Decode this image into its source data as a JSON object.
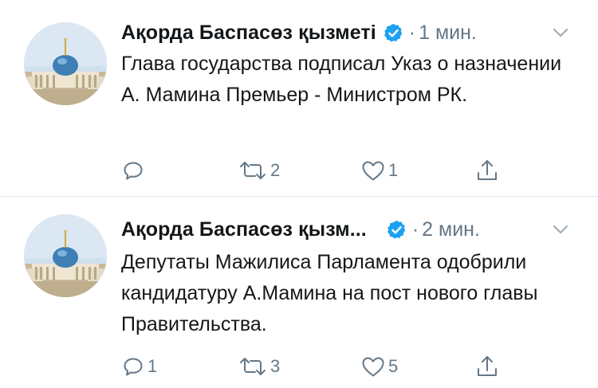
{
  "colors": {
    "text": "#14171a",
    "muted": "#657786",
    "verified": "#1da1f2",
    "divider": "#e1e8ed"
  },
  "tweets": [
    {
      "author": "Ақорда Баспасөз қызметі",
      "separator": "·",
      "time": "1 мин.",
      "text": "Глава государства подписал Указ о назначении А. Мамина Премьер - Министром РК.",
      "reply_count": "",
      "retweet_count": "2",
      "like_count": "1"
    },
    {
      "author": "Ақорда Баспасөз қызм...",
      "separator": "·",
      "time": "2 мин.",
      "text": "Депутаты Мажилиса Парламента одобрили кандидатуру А.Мамина на пост нового главы Правительства.",
      "reply_count": "1",
      "retweet_count": "3",
      "like_count": "5"
    }
  ],
  "icons": {
    "avatar": "akorda-palace-avatar",
    "verified": "verified-badge-icon",
    "caret": "chevron-down-icon",
    "reply": "reply-icon",
    "retweet": "retweet-icon",
    "like": "heart-icon",
    "share": "share-icon"
  }
}
